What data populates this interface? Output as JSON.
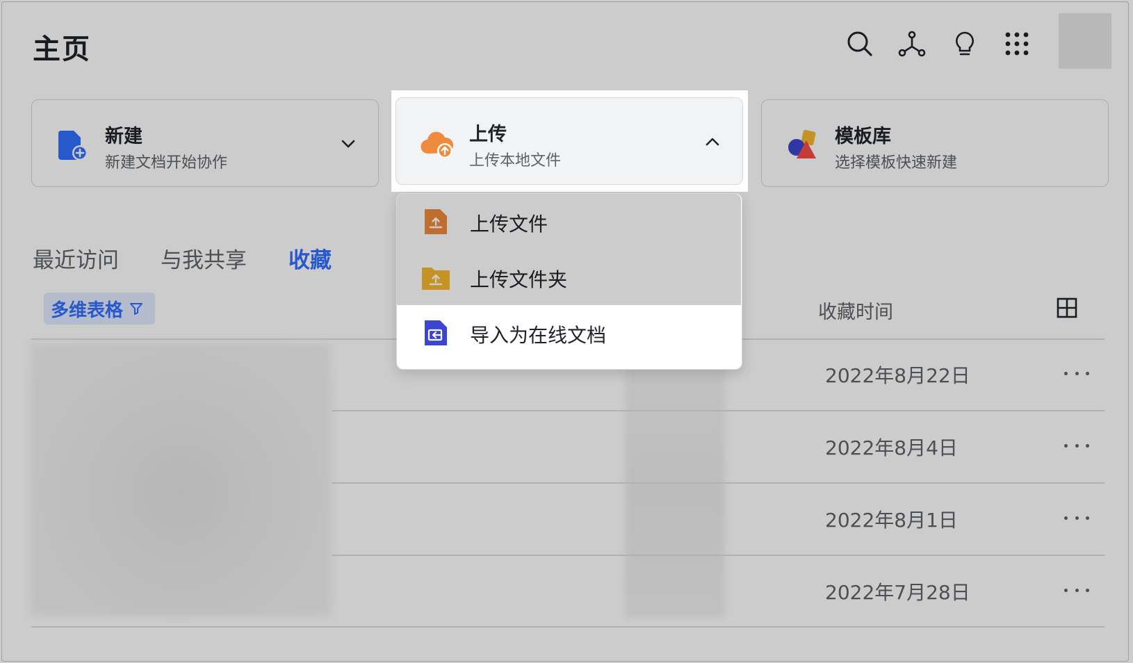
{
  "page": {
    "title": "主页"
  },
  "header_icons": [
    "search-icon",
    "network-icon",
    "lightbulb-icon",
    "apps-grid-icon"
  ],
  "cards": {
    "new": {
      "title": "新建",
      "subtitle": "新建文档开始协作"
    },
    "upload": {
      "title": "上传",
      "subtitle": "上传本地文件"
    },
    "templates": {
      "title": "模板库",
      "subtitle": "选择模板快速新建"
    }
  },
  "upload_menu": {
    "items": [
      {
        "label": "上传文件",
        "icon": "file-upload-icon"
      },
      {
        "label": "上传文件夹",
        "icon": "folder-upload-icon"
      },
      {
        "label": "导入为在线文档",
        "icon": "import-doc-icon"
      }
    ]
  },
  "tabs": [
    "最近访问",
    "与我共享",
    "收藏"
  ],
  "active_tab": "收藏",
  "filter": {
    "label": "多维表格"
  },
  "list": {
    "column_header": "收藏时间",
    "rows": [
      {
        "date": "2022年8月22日"
      },
      {
        "date": "2022年8月4日"
      },
      {
        "date": "2022年8月1日"
      },
      {
        "date": "2022年7月28日"
      }
    ]
  },
  "colors": {
    "accent": "#3370ff",
    "upload_orange": "#f08a3c",
    "dim_overlay": "rgba(0,0,0,0.2)"
  }
}
